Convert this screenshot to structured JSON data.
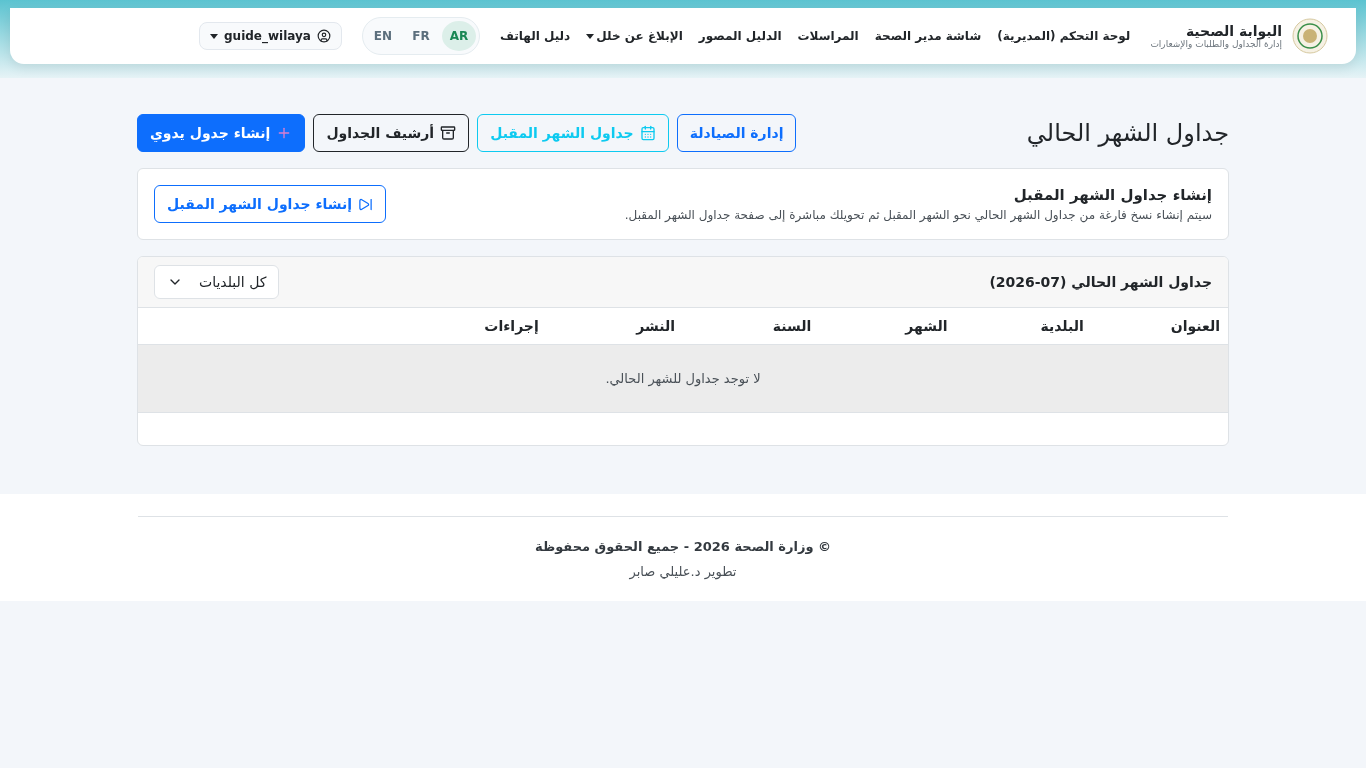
{
  "brand": {
    "title": "البوابة الصحية",
    "subtitle": "إدارة الجداول والطلبات والإشعارات"
  },
  "nav": [
    {
      "label": "لوحة التحكم (المديرية)",
      "dropdown": false
    },
    {
      "label": "شاشة مدير الصحة",
      "dropdown": false
    },
    {
      "label": "المراسلات",
      "dropdown": false
    },
    {
      "label": "الدليل المصور",
      "dropdown": false
    },
    {
      "label": "الإبلاغ عن خلل",
      "dropdown": true
    },
    {
      "label": "دليل الهاتف",
      "dropdown": false
    }
  ],
  "languages": [
    {
      "label": "AR",
      "selected": true
    },
    {
      "label": "FR",
      "selected": false
    },
    {
      "label": "EN",
      "selected": false
    }
  ],
  "user": {
    "name": "guide_wilaya"
  },
  "page_title": "جداول الشهر الحالي",
  "actions": [
    {
      "label": "إدارة الصيادلة",
      "kind": "outline-primary"
    },
    {
      "label": "جداول الشهر المقبل",
      "kind": "outline-info"
    },
    {
      "label": "أرشيف الجداول",
      "kind": "outline-dark"
    },
    {
      "label": "إنشاء جدول يدوي",
      "kind": "primary"
    }
  ],
  "next_month_card": {
    "title": "إنشاء جداول الشهر المقبل",
    "description": "سيتم إنشاء نسخ فارغة من جداول الشهر الحالي نحو الشهر المقبل ثم تحويلك مباشرة إلى صفحة جداول الشهر المقبل.",
    "button": "إنشاء جداول الشهر المقبل"
  },
  "table": {
    "title": "جداول الشهر الحالي (07-2026)",
    "filter": "كل البلديات",
    "columns": [
      "العنوان",
      "البلدية",
      "الشهر",
      "السنة",
      "النشر",
      "إجراءات"
    ],
    "empty_message": "لا توجد جداول للشهر الحالي."
  },
  "footer": {
    "copyright": "© وزارة الصحة 2026 - جميع الحقوق محفوظة",
    "credit": "تطوير د.عليلي صابر"
  }
}
